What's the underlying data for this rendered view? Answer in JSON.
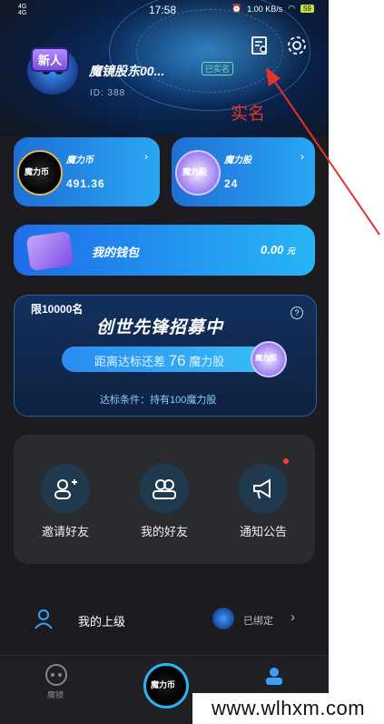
{
  "status_bar": {
    "signal_left_top": "4G",
    "signal_left_bottom": "4G",
    "time": "17:58",
    "speed": "1.00 KB/s",
    "battery": "59"
  },
  "profile": {
    "new_badge": "新人",
    "username": "魔镜股东00...",
    "verified_tag": "已实名",
    "user_id": "ID: 388"
  },
  "cards": {
    "coin": {
      "coin_text": "魔力币",
      "label": "魔力币",
      "value": "491.36"
    },
    "stock": {
      "coin_text": "魔力股",
      "label": "魔力股",
      "value": "24"
    }
  },
  "wallet": {
    "label": "我的钱包",
    "value": "0.00",
    "unit": "元"
  },
  "recruit": {
    "limit": "限10000名",
    "title": "创世先锋招募中",
    "progress_prefix": "距离达标还差",
    "progress_number": "76",
    "progress_suffix": "魔力股",
    "coin_text": "魔力股",
    "condition": "达标条件：持有100魔力股"
  },
  "menu": {
    "invite": "邀请好友",
    "friends": "我的好友",
    "notices": "通知公告"
  },
  "superior": {
    "label": "我的上级",
    "status": "已绑定"
  },
  "tabbar": {
    "left": "魔镜",
    "center": "魔力币"
  },
  "annotation": {
    "text": "实名"
  },
  "watermark": "www.wlhxm.com",
  "colors": {
    "accent": "#27b5f5",
    "annotation": "#e5322b",
    "reddot": "#ff3b30"
  }
}
